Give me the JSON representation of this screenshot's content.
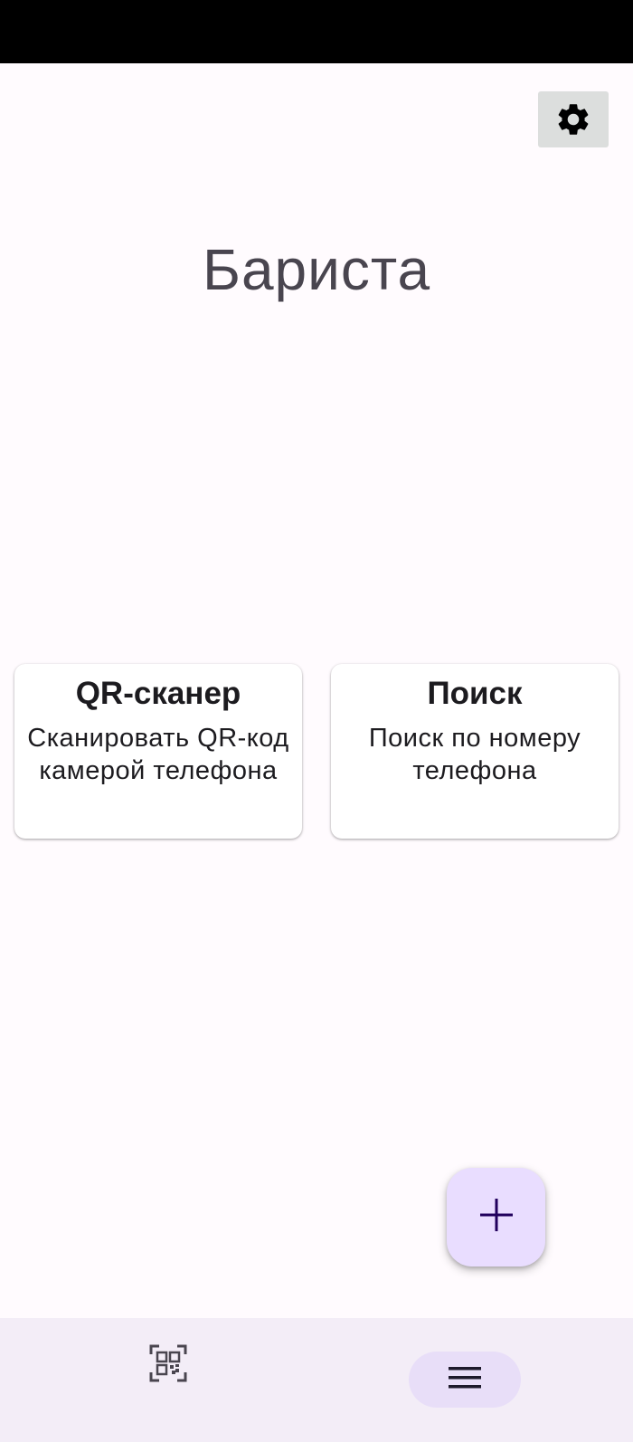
{
  "app": {
    "title": "Бариста"
  },
  "header": {
    "settings_icon": "gear-icon"
  },
  "cards": [
    {
      "title": "QR-сканер",
      "description_line1": "Сканировать QR-код",
      "description_line2": "камерой телефона"
    },
    {
      "title": "Поиск",
      "description_line1": "Поиск по номеру",
      "description_line2": "телефона"
    }
  ],
  "fab": {
    "icon": "plus-icon"
  },
  "bottom_nav": {
    "items": [
      {
        "icon": "qr-code-icon",
        "selected": false
      },
      {
        "icon": "menu-icon",
        "selected": true
      }
    ]
  },
  "colors": {
    "background": "#fffbfe",
    "title_text": "#49454f",
    "fab_background": "#e9ddff",
    "fab_icon": "#21005d",
    "nav_background": "#f3edf7",
    "nav_active_indicator": "#e8def8"
  }
}
